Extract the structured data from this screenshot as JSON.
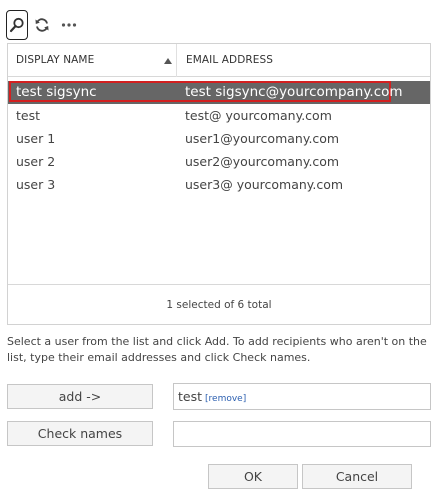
{
  "toolbar": {
    "icons": [
      "search-icon",
      "refresh-icon",
      "more-icon"
    ]
  },
  "grid": {
    "columns": {
      "display_name": "DISPLAY NAME",
      "email_address": "EMAIL ADDRESS"
    },
    "rows": [
      {
        "name": "test sigsync",
        "email": "test sigsync@yourcompany.com",
        "selected": true
      },
      {
        "name": "test",
        "email": "test@ yourcomany.com",
        "selected": false
      },
      {
        "name": "user 1",
        "email": "user1@yourcomany.com",
        "selected": false
      },
      {
        "name": "user 2",
        "email": "user2@yourcomany.com",
        "selected": false
      },
      {
        "name": "user 3",
        "email": "user3@ yourcomany.com",
        "selected": false
      }
    ],
    "status": "1 selected of 6 total"
  },
  "help_text": "Select a user from the list and click Add. To add recipients who aren't on the list, type their email addresses and click Check names.",
  "add_button": "add ->",
  "recipients": {
    "value": "test",
    "remove_link": "[remove]"
  },
  "check_names_button": "Check names",
  "check_names_input": "",
  "ok_button": "OK",
  "cancel_button": "Cancel",
  "colors": {
    "selected_row": "#666666",
    "highlight_border": "#d32020",
    "link": "#2b5fb0"
  }
}
